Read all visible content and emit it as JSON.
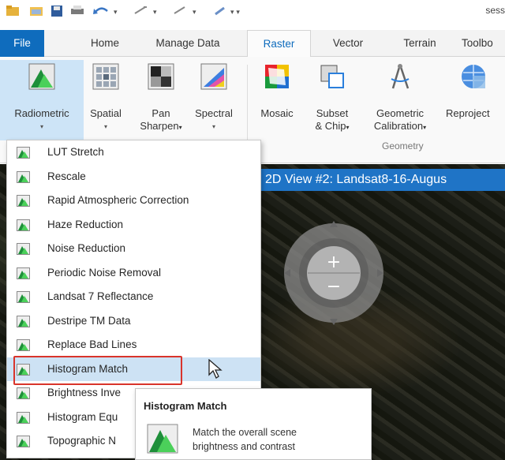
{
  "window": {
    "title_fragment": "sess"
  },
  "tabs": [
    {
      "label": "File"
    },
    {
      "label": "Home"
    },
    {
      "label": "Manage Data"
    },
    {
      "label": "Raster"
    },
    {
      "label": "Vector"
    },
    {
      "label": "Terrain"
    },
    {
      "label": "Toolbo"
    }
  ],
  "ribbon": {
    "radiometric": "Radiometric",
    "spatial": "Spatial",
    "pan_line1": "Pan",
    "pan_line2": "Sharpen",
    "spectral": "Spectral",
    "mosaic": "Mosaic",
    "subset_line1": "Subset",
    "subset_line2": "& Chip",
    "geometric_line1": "Geometric",
    "geometric_line2": "Calibration",
    "reproject": "Reproject",
    "group_geometry": "Geometry"
  },
  "view": {
    "title": "2D View #2: Landsat8-16-Augus"
  },
  "menu": {
    "items": [
      "LUT Stretch",
      "Rescale",
      "Rapid Atmospheric Correction",
      "Haze Reduction",
      "Noise Reduction",
      "Periodic Noise Removal",
      "Landsat 7 Reflectance",
      "Destripe TM Data",
      "Replace Bad Lines",
      "Histogram Match",
      "Brightness Inve",
      "Histogram Equ",
      "Topographic N"
    ],
    "highlighted_index": 9
  },
  "tooltip": {
    "title": "Histogram Match",
    "line1": "Match the overall scene",
    "line2": "brightness and contrast"
  },
  "colors": {
    "accent": "#0f6cbd",
    "view_title_bg": "#1f74c6",
    "highlight": "#cde2f4",
    "callout_border": "#d9342b"
  }
}
